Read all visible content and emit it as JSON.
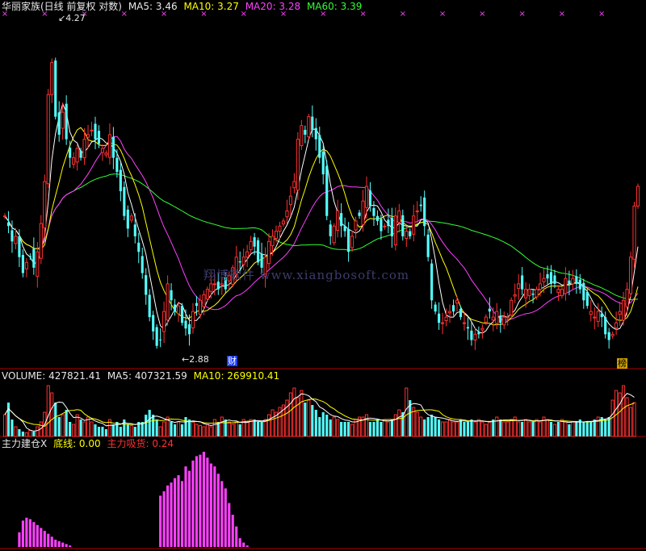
{
  "panels": {
    "price": {
      "name": "华丽家族(日线 前复权 对数)",
      "ma5_label": "MA5: 3.46",
      "ma10_label": "MA10: 3.27",
      "ma20_label": "MA20: 3.28",
      "ma60_label": "MA60: 3.39",
      "high_mark": "4.27",
      "low_mark": "2.88",
      "badge_cai": "财",
      "badge_bang": "榜"
    },
    "volume": {
      "name": "VOLUME: 427821.41",
      "ma5_label": "MA5: 407321.59",
      "ma10_label": "MA10: 269910.41"
    },
    "indicator": {
      "name": "主力建仓X",
      "baseline_label": "底线: 0.00",
      "absorb_label": "主力吸货: 0.24"
    }
  },
  "watermark": "翔博软件 www.xiangbosoft.com",
  "colors": {
    "up": "#ff3030",
    "down": "#54ffff",
    "ma5": "#ffffff",
    "ma10": "#ffff00",
    "ma20": "#ff40ff",
    "ma60": "#33ff33",
    "indicator_bar": "#ff40ff",
    "grid_line": "#b00000"
  },
  "chart_data": [
    {
      "type": "candlestick",
      "title": "华丽家族(日线 前复权 对数)",
      "scale": "log",
      "y_marks": {
        "high": 4.27,
        "low": 2.88
      },
      "closes": [
        3.38,
        3.34,
        3.28,
        3.3,
        3.22,
        3.16,
        3.2,
        3.22,
        3.18,
        3.24,
        3.35,
        3.52,
        3.9,
        4.05,
        3.8,
        3.72,
        3.82,
        3.7,
        3.62,
        3.62,
        3.66,
        3.62,
        3.7,
        3.72,
        3.74,
        3.7,
        3.68,
        3.66,
        3.64,
        3.72,
        3.62,
        3.56,
        3.48,
        3.38,
        3.33,
        3.38,
        3.3,
        3.24,
        3.16,
        3.08,
        3.0,
        2.95,
        2.9,
        2.92,
        3.02,
        3.12,
        3.06,
        3.02,
        3.04,
        2.98,
        2.96,
        2.94,
        3.02,
        3.04,
        3.06,
        3.08,
        3.1,
        3.12,
        3.12,
        3.1,
        3.12,
        3.1,
        3.15,
        3.18,
        3.22,
        3.2,
        3.22,
        3.24,
        3.28,
        3.26,
        3.2,
        3.18,
        3.22,
        3.28,
        3.3,
        3.32,
        3.34,
        3.36,
        3.4,
        3.46,
        3.52,
        3.7,
        3.76,
        3.72,
        3.8,
        3.74,
        3.7,
        3.62,
        3.55,
        3.38,
        3.3,
        3.34,
        3.4,
        3.34,
        3.32,
        3.24,
        3.3,
        3.36,
        3.38,
        3.44,
        3.5,
        3.42,
        3.38,
        3.36,
        3.32,
        3.34,
        3.34,
        3.3,
        3.38,
        3.4,
        3.3,
        3.32,
        3.3,
        3.38,
        3.4,
        3.42,
        3.34,
        3.22,
        3.06,
        3.02,
        2.98,
        2.98,
        3.0,
        3.02,
        3.02,
        3.06,
        3.0,
        2.98,
        2.96,
        2.92,
        2.94,
        2.94,
        2.96,
        3.0,
        3.02,
        3.0,
        3.02,
        2.98,
        3.0,
        3.0,
        3.06,
        3.08,
        3.12,
        3.1,
        3.1,
        3.1,
        3.08,
        3.1,
        3.12,
        3.14,
        3.14,
        3.12,
        3.12,
        3.1,
        3.1,
        3.14,
        3.12,
        3.14,
        3.12,
        3.1,
        3.06,
        3.04,
        3.02,
        3.0,
        3.02,
        3.0,
        2.94,
        2.92,
        2.94,
        2.98,
        3.02,
        3.06,
        3.1,
        3.22,
        3.42,
        3.5
      ]
    },
    {
      "type": "bar",
      "title": "VOLUME: 427821.41",
      "series": [
        {
          "name": "VOLUME",
          "values": [
            90,
            140,
            70,
            40,
            30,
            20,
            15,
            25,
            20,
            40,
            60,
            100,
            210,
            180,
            140,
            80,
            90,
            110,
            60,
            50,
            90,
            70,
            60,
            80,
            60,
            50,
            40,
            40,
            30,
            70,
            50,
            60,
            40,
            70,
            50,
            45,
            40,
            60,
            60,
            90,
            110,
            90,
            70,
            40,
            60,
            80,
            60,
            50,
            60,
            50,
            80,
            70,
            60,
            50,
            45,
            40,
            50,
            40,
            70,
            60,
            80,
            70,
            60,
            50,
            60,
            50,
            70,
            60,
            70,
            70,
            60,
            60,
            70,
            90,
            110,
            100,
            120,
            130,
            150,
            180,
            200,
            160,
            190,
            140,
            150,
            130,
            110,
            80,
            100,
            90,
            70,
            80,
            70,
            60,
            60,
            60,
            50,
            70,
            80,
            80,
            90,
            60,
            60,
            70,
            60,
            70,
            60,
            70,
            90,
            110,
            100,
            200,
            150,
            120,
            100,
            80,
            70,
            80,
            90,
            80,
            70,
            60,
            60,
            70,
            60,
            60,
            70,
            60,
            60,
            70,
            60,
            70,
            60,
            50,
            60,
            70,
            80,
            70,
            60,
            60,
            70,
            80,
            60,
            60,
            70,
            60,
            60,
            70,
            60,
            80,
            70,
            60,
            50,
            60,
            70,
            60,
            50,
            60,
            60,
            70,
            60,
            60,
            60,
            70,
            80,
            80,
            70,
            80,
            150,
            190,
            180,
            210,
            160,
            120,
            140
          ]
        }
      ]
    },
    {
      "type": "bar",
      "title": "主力建仓X",
      "series": [
        {
          "name": "主力吸货",
          "values": [
            0,
            0,
            0,
            0,
            10,
            18,
            20,
            19,
            17,
            15,
            13,
            11,
            9,
            7,
            5,
            4,
            3,
            2,
            1,
            0,
            0,
            0,
            0,
            0,
            0,
            0,
            0,
            0,
            0,
            0,
            0,
            0,
            0,
            0,
            0,
            0,
            0,
            0,
            0,
            0,
            0,
            0,
            0,
            35,
            38,
            42,
            44,
            47,
            49,
            45,
            55,
            52,
            59,
            62,
            63,
            65,
            61,
            57,
            55,
            50,
            45,
            40,
            30,
            22,
            14,
            6,
            3,
            1,
            0,
            0,
            0,
            0,
            0,
            0,
            0,
            0,
            0,
            0,
            0,
            0,
            0,
            0,
            0,
            0,
            0,
            0,
            0,
            0,
            0,
            0,
            0,
            0,
            0,
            0,
            0,
            0,
            0,
            0,
            0,
            0,
            0,
            0,
            0,
            0,
            0,
            0,
            0,
            0,
            0,
            0,
            0,
            0,
            0,
            0,
            0,
            0,
            0,
            0,
            0,
            0,
            0,
            0,
            0,
            0,
            0,
            0,
            0,
            0,
            0,
            0,
            0,
            0,
            0,
            0,
            0,
            0,
            0,
            0,
            0,
            0,
            0,
            0,
            0,
            0,
            0,
            0,
            0,
            0,
            0,
            0,
            0,
            0,
            0,
            0,
            0,
            0,
            0,
            0,
            0,
            0,
            0,
            0,
            0,
            0,
            0,
            0,
            0,
            0,
            0,
            0,
            0,
            0,
            0,
            0,
            0,
            0,
            0,
            0,
            0,
            0,
            0,
            0,
            0,
            0,
            0,
            0,
            0,
            0,
            0,
            0,
            0,
            0,
            0,
            0,
            0,
            0,
            0,
            0,
            0,
            0,
            0,
            0,
            0
          ]
        }
      ]
    }
  ]
}
